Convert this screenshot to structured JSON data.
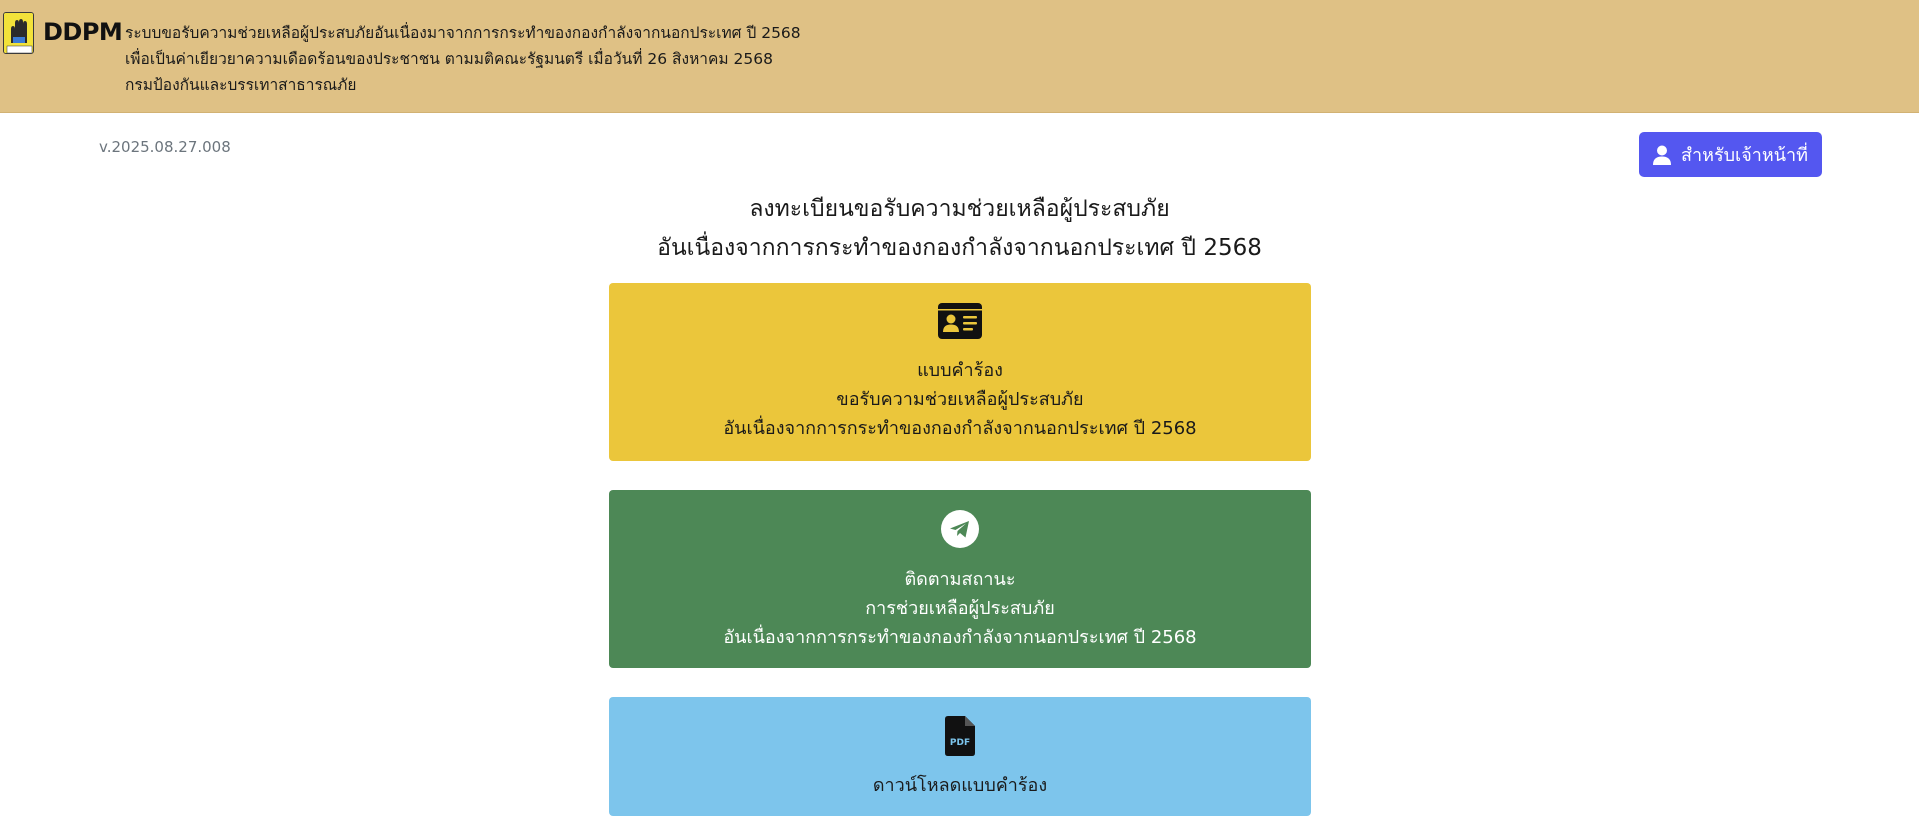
{
  "header": {
    "logo_text": "DDPM",
    "line1": "ระบบขอรับความช่วยเหลือผู้ประสบภัยอันเนื่องมาจากการกระทำของกองกำลังจากนอกประเทศ ปี 2568",
    "line2": "เพื่อเป็นค่าเยียวยาความเดือดร้อนของประชาชน ตามมติคณะรัฐมนตรี เมื่อวันที่ 26 สิงหาคม 2568",
    "line3": "กรมป้องกันและบรรเทาสาธารณภัย",
    "background_color": "#dfc185"
  },
  "version": "v.2025.08.27.008",
  "staff_button": {
    "label": "สำหรับเจ้าหน้าที่",
    "icon": "user-icon",
    "color": "#5457f0"
  },
  "title": {
    "line1": "ลงทะเบียนขอรับความช่วยเหลือผู้ประสบภัย",
    "line2": "อันเนื่องจากการกระทำของกองกำลังจากนอกประเทศ ปี 2568"
  },
  "cards": [
    {
      "icon": "id-card-icon",
      "line1": "แบบคำร้อง",
      "line2": "ขอรับความช่วยเหลือผู้ประสบภัย",
      "line3": "อันเนื่องจากการกระทำของกองกำลังจากนอกประเทศ ปี 2568",
      "color": "#ebc63b"
    },
    {
      "icon": "telegram-icon",
      "line1": "ติดตามสถานะ",
      "line2": "การช่วยเหลือผู้ประสบภัย",
      "line3": "อันเนื่องจากการกระทำของกองกำลังจากนอกประเทศ ปี 2568",
      "color": "#4d8856"
    },
    {
      "icon": "pdf-file-icon",
      "line1": "ดาวน์โหลดแบบคำร้อง",
      "color": "#7dc5ec"
    }
  ]
}
